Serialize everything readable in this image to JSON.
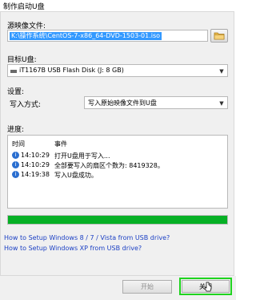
{
  "window": {
    "title": "制作启动U盘"
  },
  "source": {
    "label": "源映像文件:",
    "value": "K:\\操作系统\\CentOS-7-x86_64-DVD-1503-01.iso",
    "browse_icon": "folder-icon"
  },
  "usb": {
    "label": "目标U盘:",
    "value": "iT1167B USB Flash Disk (J: 8 GB)"
  },
  "settings": {
    "label": "设置:",
    "write_mode_label": "写入方式:",
    "write_mode_value": "写入原始映像文件到U盘"
  },
  "progress": {
    "label": "进度:",
    "headers": {
      "time": "时间",
      "event": "事件"
    },
    "log": [
      {
        "time": "14:10:29",
        "event": "打开U盘用于写入..."
      },
      {
        "time": "14:10:29",
        "event": "全部要写入的扇区个数为: 8419328。"
      },
      {
        "time": "14:19:38",
        "event": "写入U盘成功。"
      }
    ],
    "percent": 100,
    "bar_color": "#06b025"
  },
  "links": [
    "How to Setup Windows 8 / 7 / Vista from USB drive?",
    "How to Setup Windows XP from USB drive?"
  ],
  "buttons": {
    "start": "开始",
    "close": "关闭"
  },
  "colors": {
    "highlight": "#1fd41f",
    "selection": "#3399ff",
    "link": "#1a3fc4"
  }
}
